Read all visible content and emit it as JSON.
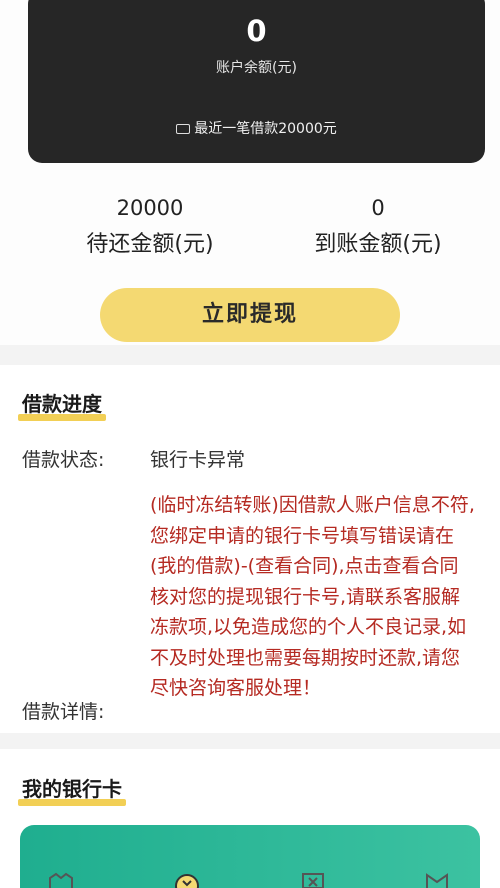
{
  "balance": {
    "value": "0",
    "label": "账户余额(元)",
    "recent": "最近一笔借款20000元"
  },
  "stats": {
    "pending_value": "20000",
    "pending_label": "待还金额(元)",
    "received_value": "0",
    "received_label": "到账金额(元)"
  },
  "withdraw_label": "立即提现",
  "progress": {
    "title": "借款进度",
    "status_key": "借款状态:",
    "status_value": "银行卡异常",
    "detail_key": "借款详情:",
    "detail_value": "(临时冻结转账)因借款人账户信息不符,您绑定申请的银行卡号填写错误请在(我的借款)-(查看合同),点击查看合同核对您的提现银行卡号,请联系客服解冻款项,以免造成您的个人不良记录,如不及时处理也需要每期按时还款,请您尽快咨询客服处理！"
  },
  "bank": {
    "title": "我的银行卡"
  },
  "icons": {
    "recent": "card-icon",
    "tabs": [
      "home-icon",
      "borrow-icon",
      "bill-icon",
      "profile-icon"
    ]
  },
  "colors": {
    "accent": "#f4d972",
    "alert": "#b52a22",
    "card": "#262626",
    "bank_card": "#1fae8f"
  }
}
